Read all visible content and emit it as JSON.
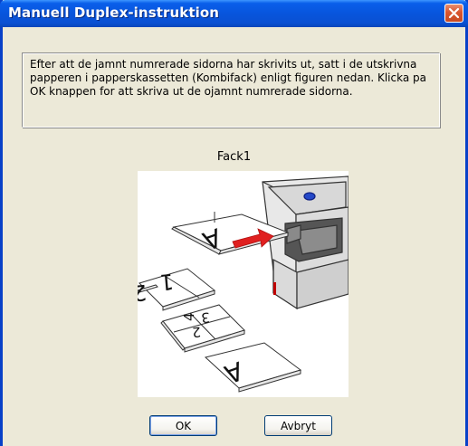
{
  "window": {
    "title": "Manuell Duplex-instruktion",
    "close_icon": "close-icon"
  },
  "message": "Efter att de jamnt numrerade sidorna har skrivits ut, satt i de utskrivna papperen i papperskassetten (Kombifack) enligt figuren nedan. Klicka pa OK knappen for att skriva ut de ojamnt numrerade sidorna.",
  "tray_label": "Fack1",
  "illustration": {
    "paper_glyphs": [
      "A",
      "1",
      "2",
      "3",
      "4",
      "2",
      "A"
    ]
  },
  "buttons": {
    "ok": "OK",
    "cancel": "Avbryt"
  },
  "colors": {
    "title_bar": "#0855DD",
    "dialog_bg": "#ECE9D8",
    "close_button": "#D9552F",
    "arrow": "#E02020"
  }
}
